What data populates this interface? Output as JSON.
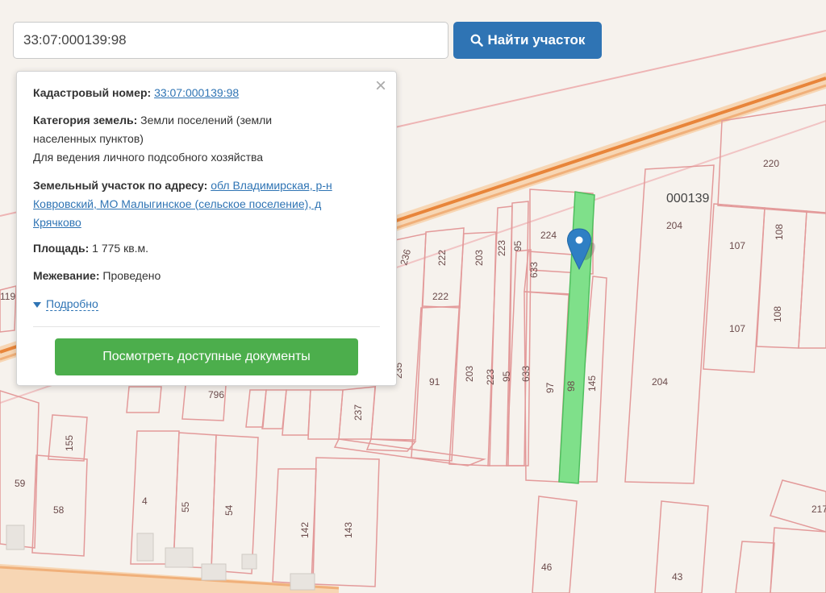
{
  "search": {
    "value": "33:07:000139:98",
    "button_label": "Найти участок",
    "button_icon": "search-icon"
  },
  "popup": {
    "cadastral_label": "Кадастровый номер:",
    "cadastral_value": "33:07:000139:98",
    "category_label": "Категория земель:",
    "category_value_1": "Земли поселений (земли",
    "category_value_2": "населенных пунктов)",
    "usage": "Для ведения личного подсобного хозяйства",
    "address_label": "Земельный участок по адресу:",
    "address_1": "обл Владимирская, р-н",
    "address_2": "Ковровский, МО Малыгинское (сельское поселение), д",
    "address_3": "Крячково",
    "area_label": "Площадь:",
    "area_value": "1 775 кв.м.",
    "survey_label": "Межевание:",
    "survey_value": "Проведено",
    "more_label": "Подробно",
    "docs_button": "Посмотреть доступные документы",
    "close_icon": "close-icon"
  },
  "map": {
    "parcel_labels": [
      "000139",
      "220",
      "204",
      "107",
      "108",
      "107",
      "108",
      "204",
      "224",
      "222",
      "222",
      "236",
      "203",
      "223",
      "95",
      "633",
      "633",
      "95",
      "223",
      "203",
      "91",
      "97",
      "98",
      "145",
      "237",
      "155",
      "59",
      "58",
      "4",
      "55",
      "54",
      "142",
      "143",
      "46",
      "43",
      "217",
      "119",
      "796",
      "235"
    ],
    "colors": {
      "background": "#f6f2ed",
      "boundary": "#e8a0a0",
      "road": "#f4c28a",
      "highlight": "#7fe08a",
      "marker": "#2f7fc4"
    }
  }
}
